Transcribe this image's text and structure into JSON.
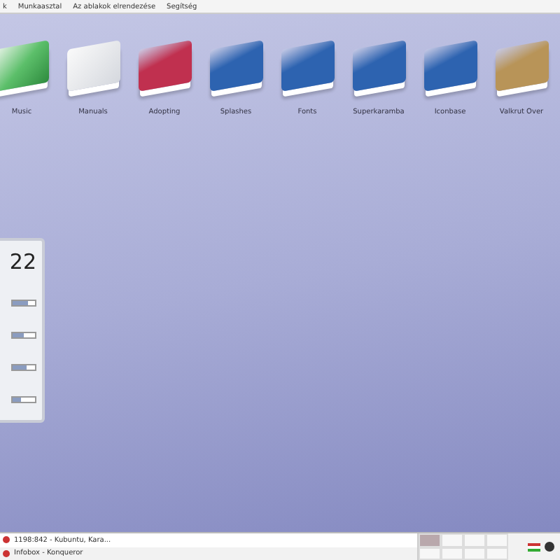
{
  "menu_bar": {
    "items": [
      "k",
      "Munkaasztal",
      "Az ablakok elrendezése",
      "Segítség"
    ]
  },
  "desktop_icons": [
    {
      "label": "Music",
      "kind": "music"
    },
    {
      "label": "Manuals",
      "kind": "manual"
    },
    {
      "label": "Adopting",
      "kind": "book",
      "color": "#c0304f"
    },
    {
      "label": "Splashes",
      "kind": "book",
      "color": "#2d63b0"
    },
    {
      "label": "Fonts",
      "kind": "book",
      "color": "#2d63b0"
    },
    {
      "label": "Superkaramba",
      "kind": "book",
      "color": "#2d63b0"
    },
    {
      "label": "Iconbase",
      "kind": "book",
      "color": "#2d63b0"
    },
    {
      "label": "Valkrut Over",
      "kind": "book",
      "color": "#b89458"
    }
  ],
  "widget": {
    "clock": "22",
    "meters": [
      {
        "level": 0.7
      },
      {
        "level": 0.5
      },
      {
        "level": 0.6
      },
      {
        "level": 0.4
      }
    ]
  },
  "taskbar": {
    "tasks": [
      {
        "title": "1198:842 - Kubuntu, Kara...",
        "selected": true
      },
      {
        "title": "Infobox - Konqueror",
        "selected": false
      }
    ]
  }
}
